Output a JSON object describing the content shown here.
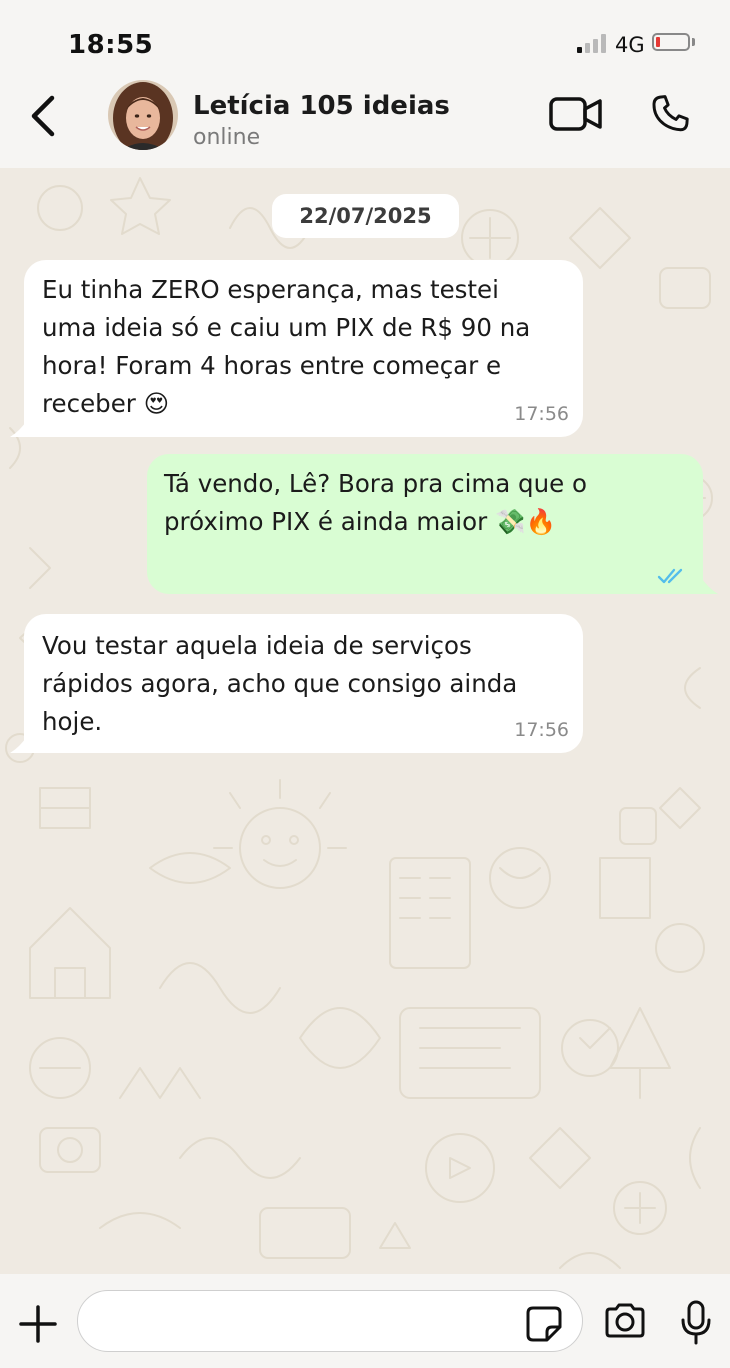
{
  "status_bar": {
    "time": "18:55",
    "network": "4G",
    "signal_bars_active": 1,
    "signal_bars_total": 4,
    "battery_level": 0.1
  },
  "header": {
    "contact_name": "Letícia 105 ideias",
    "contact_status": "online",
    "icons": {
      "back": "chevron-left-icon",
      "video": "video-camera-icon",
      "call": "phone-icon"
    }
  },
  "chat": {
    "date_label": "22/07/2025",
    "messages": [
      {
        "direction": "incoming",
        "text": "Eu tinha ZERO esperança, mas testei\numa ideia só e caiu um PIX de R$ 90 na\nhora! Foram 4 horas entre começar e\nreceber 😍",
        "time": "17:56"
      },
      {
        "direction": "outgoing",
        "text": "Tá vendo, Lê? Bora pra cima que o\npróximo PIX é ainda maior 💸🔥",
        "status": "read"
      },
      {
        "direction": "incoming",
        "text": "Vou testar aquela ideia de serviços\nrápidos agora, acho que consigo ainda\nhoje.",
        "time": "17:56"
      }
    ]
  },
  "input_bar": {
    "placeholder": "",
    "icons": {
      "attach": "plus-icon",
      "sticker": "sticker-icon",
      "camera": "camera-icon",
      "mic": "microphone-icon"
    }
  },
  "colors": {
    "chat_background": "#efeae2",
    "incoming_bubble": "#ffffff",
    "outgoing_bubble": "#d9fdd3",
    "read_ticks": "#53bdeb",
    "battery_low": "#e53935"
  }
}
